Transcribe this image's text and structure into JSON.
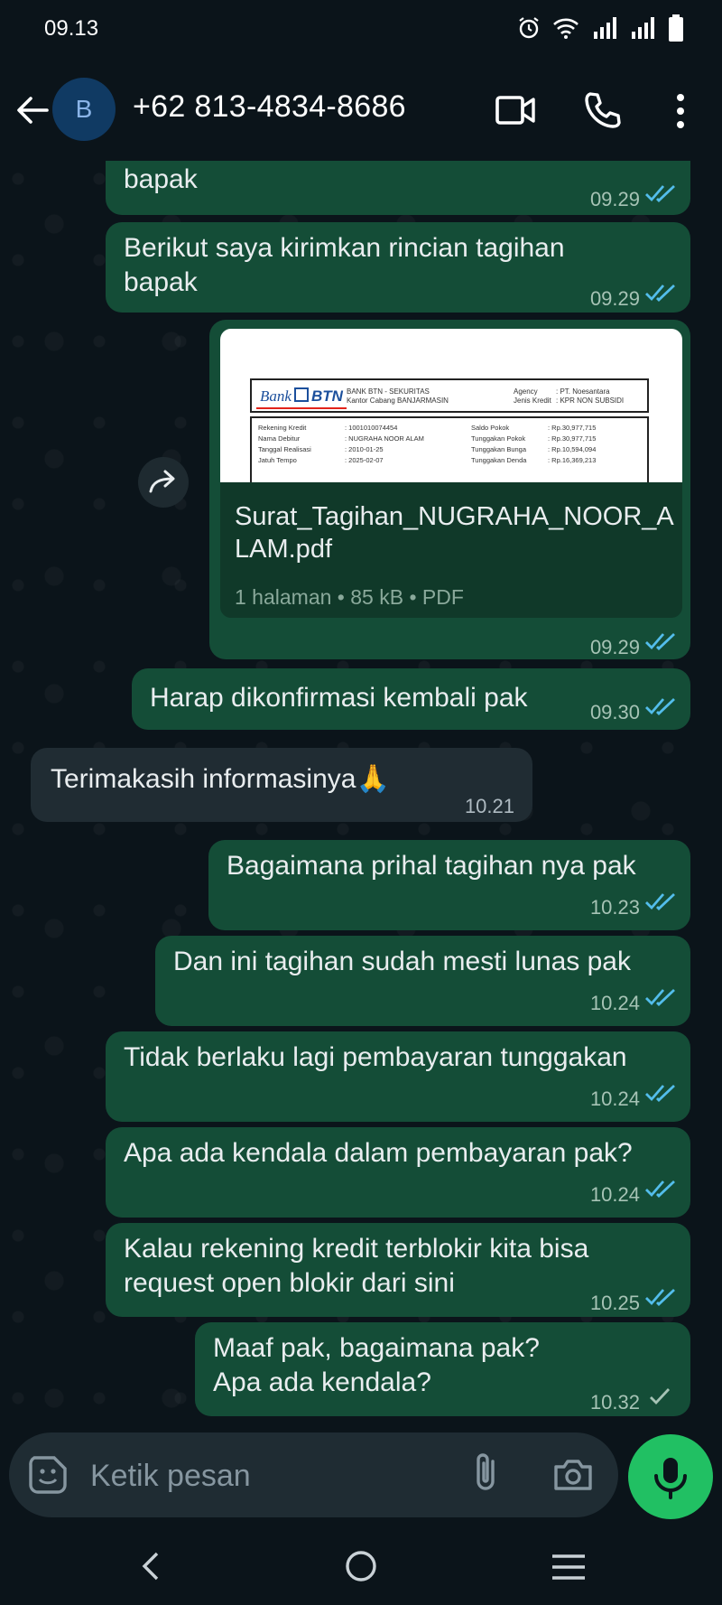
{
  "status_bar": {
    "time": "09.13"
  },
  "header": {
    "avatar_letter": "B",
    "contact": "+62 813-4834-8686"
  },
  "messages": [
    {
      "text": "bapak",
      "time": "09.29"
    },
    {
      "text_line1": "Berikut saya kirimkan rincian tagihan",
      "text_line2": "bapak",
      "time": "09.29"
    },
    {
      "doc_name": "Surat_Tagihan_NUGRAHA_NOOR_ALAM.pdf",
      "doc_meta": "1 halaman • 85 kB • PDF",
      "time": "09.29",
      "preview": {
        "bank": "Bank",
        "btn": "BTN",
        "header_line1": "BANK BTN - SEKURITAS",
        "header_line2": "Kantor Cabang BANJARMASIN",
        "agency_label": "Agency",
        "agency_value": ": PT. Noesantara",
        "jenis_label": "Jenis Kredit",
        "jenis_value": ": KPR NON SUBSIDI",
        "rows": [
          {
            "l_label": "Rekening Kredit",
            "l_value": ": 1001010074454",
            "r_label": "Saldo Pokok",
            "r_value": ": Rp.30,977,715"
          },
          {
            "l_label": "Nama Debitur",
            "l_value": ": NUGRAHA NOOR ALAM",
            "r_label": "Tunggakan Pokok",
            "r_value": ": Rp.30,977,715"
          },
          {
            "l_label": "Tanggal Realisasi",
            "l_value": ": 2010-01-25",
            "r_label": "Tunggakan Bunga",
            "r_value": ": Rp.10,594,094"
          },
          {
            "l_label": "Jatuh Tempo",
            "l_value": ": 2025-02-07",
            "r_label": "Tunggakan Denda",
            "r_value": ": Rp.16,369,213"
          }
        ]
      }
    },
    {
      "text": "Harap dikonfirmasi kembali pak",
      "time": "09.30"
    },
    {
      "text": "Terimakasih informasinya🙏",
      "time": "10.21"
    },
    {
      "text": "Bagaimana prihal tagihan nya pak",
      "time": "10.23"
    },
    {
      "text": "Dan ini tagihan sudah mesti lunas pak",
      "time": "10.24"
    },
    {
      "text": "Tidak berlaku lagi pembayaran tunggakan",
      "time": "10.24"
    },
    {
      "text": "Apa ada kendala dalam pembayaran pak?",
      "time": "10.24"
    },
    {
      "text_line1": "Kalau rekening kredit terblokir kita bisa",
      "text_line2": "request open blokir dari sini",
      "time": "10.25"
    },
    {
      "text_line1": "Maaf pak, bagaimana pak?",
      "text_line2": "Apa ada kendala?",
      "time": "10.32"
    }
  ],
  "input": {
    "placeholder": "Ketik pesan"
  },
  "colors": {
    "outgoing": "#144d37",
    "incoming": "#202c33",
    "read_tick": "#53bdeb",
    "mic": "#21c063"
  }
}
